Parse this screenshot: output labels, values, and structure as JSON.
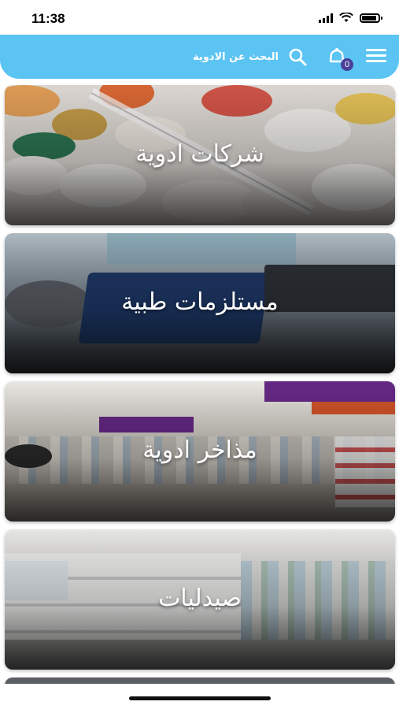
{
  "status": {
    "time": "11:38"
  },
  "header": {
    "search_label": "البحث عن الادوية",
    "cart_count": "0"
  },
  "categories": [
    {
      "label": "شركات ادوية"
    },
    {
      "label": "مستلزمات طبية"
    },
    {
      "label": "مذاخر ادوية"
    },
    {
      "label": "صيدليات"
    }
  ],
  "colors": {
    "primary": "#5cc4f3",
    "badge": "#4a3f9a"
  },
  "icons": {
    "menu": "menu-icon",
    "cart": "cart-icon",
    "search": "search-icon"
  }
}
